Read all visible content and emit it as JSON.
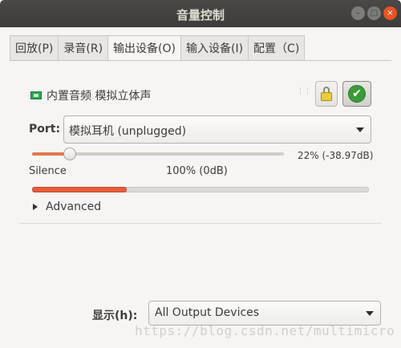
{
  "window": {
    "title": "音量控制",
    "controls": {
      "minimize": "–",
      "maximize": "□",
      "close": "×"
    }
  },
  "tabs": [
    {
      "label": "回放(P)",
      "active": false
    },
    {
      "label": "录音(R)",
      "active": false
    },
    {
      "label": "输出设备(O)",
      "active": true
    },
    {
      "label": "输入设备(I)",
      "active": false
    },
    {
      "label": "配置（C)",
      "active": false
    }
  ],
  "device": {
    "icon": "sound-card-icon",
    "name": "内置音频 模拟立体声",
    "lock_icon": "lock-icon",
    "default_icon": "checkmark-icon",
    "default_glyph": "✔"
  },
  "port": {
    "label": "Port:",
    "value": "模拟耳机 (unplugged)"
  },
  "volume": {
    "level_fraction": 0.22,
    "readout": "22% (-38.97dB)",
    "silence_label": "Silence",
    "hundred_label": "100% (0dB)"
  },
  "meter": {
    "level_fraction": 0.28
  },
  "advanced": {
    "label": "Advanced"
  },
  "footer": {
    "show_label": "显示(h):",
    "show_value": "All Output Devices"
  },
  "watermark": "https://blog.csdn.net/multimicro",
  "colors": {
    "accent": "#e95420",
    "meter": "#e95b3b",
    "ok_green": "#3a9b38"
  }
}
